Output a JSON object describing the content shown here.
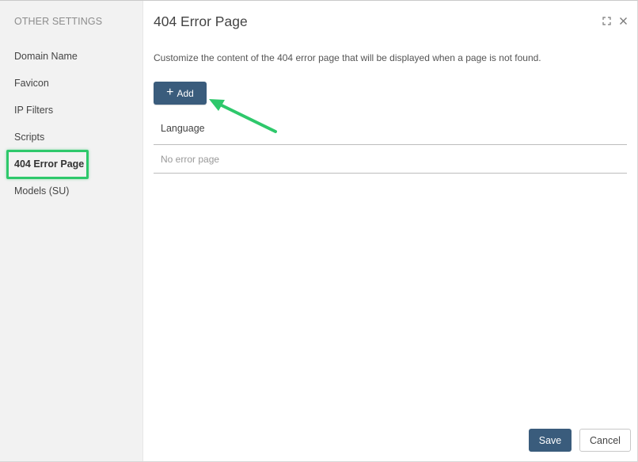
{
  "sidebar": {
    "heading": "OTHER SETTINGS",
    "items": [
      {
        "label": "Domain Name"
      },
      {
        "label": "Favicon"
      },
      {
        "label": "IP Filters"
      },
      {
        "label": "Scripts"
      },
      {
        "label": "404 Error Page",
        "active": true
      },
      {
        "label": "Models (SU)"
      }
    ]
  },
  "main": {
    "title": "404 Error Page",
    "description": "Customize the content of the 404 error page that will be displayed when a page is not found.",
    "add_label": "Add",
    "table": {
      "columns": [
        "Language"
      ],
      "empty_text": "No error page"
    },
    "window_controls": [
      "maximize-icon",
      "close-icon"
    ]
  },
  "footer": {
    "save_label": "Save",
    "cancel_label": "Cancel"
  },
  "colors": {
    "primary": "#3a5c7c",
    "highlight": "#2ec86b",
    "sidebar_bg": "#f2f2f2"
  }
}
